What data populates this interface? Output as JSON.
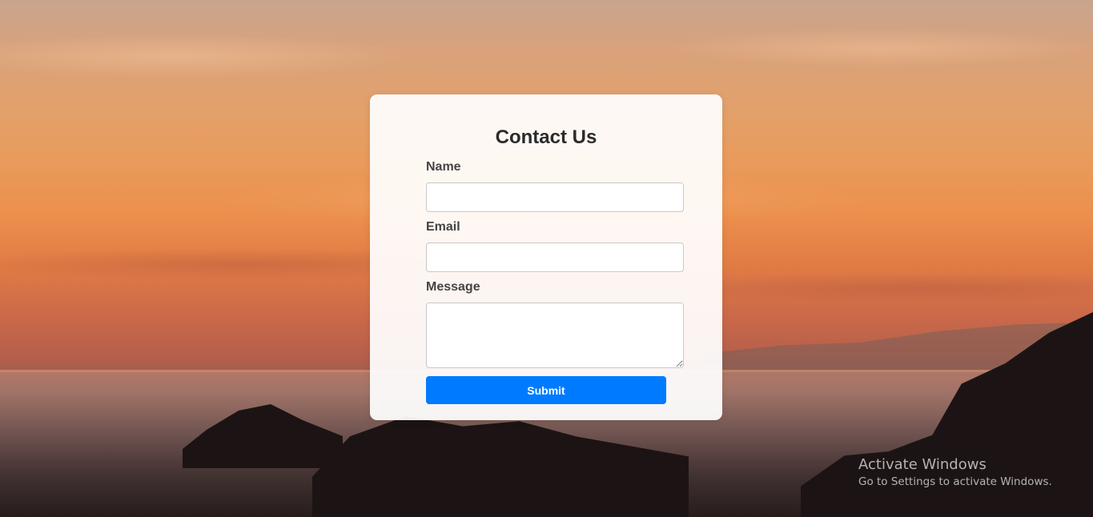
{
  "form": {
    "title": "Contact Us",
    "name_label": "Name",
    "name_value": "",
    "email_label": "Email",
    "email_value": "",
    "message_label": "Message",
    "message_value": "",
    "submit_label": "Submit"
  },
  "watermark": {
    "title": "Activate Windows",
    "subtitle": "Go to Settings to activate Windows."
  },
  "colors": {
    "accent": "#007bff",
    "card_bg": "#ffffff",
    "heading": "#2b2b2b",
    "label": "#444444"
  },
  "background": {
    "description_icon": "sunset-sea-photo"
  }
}
